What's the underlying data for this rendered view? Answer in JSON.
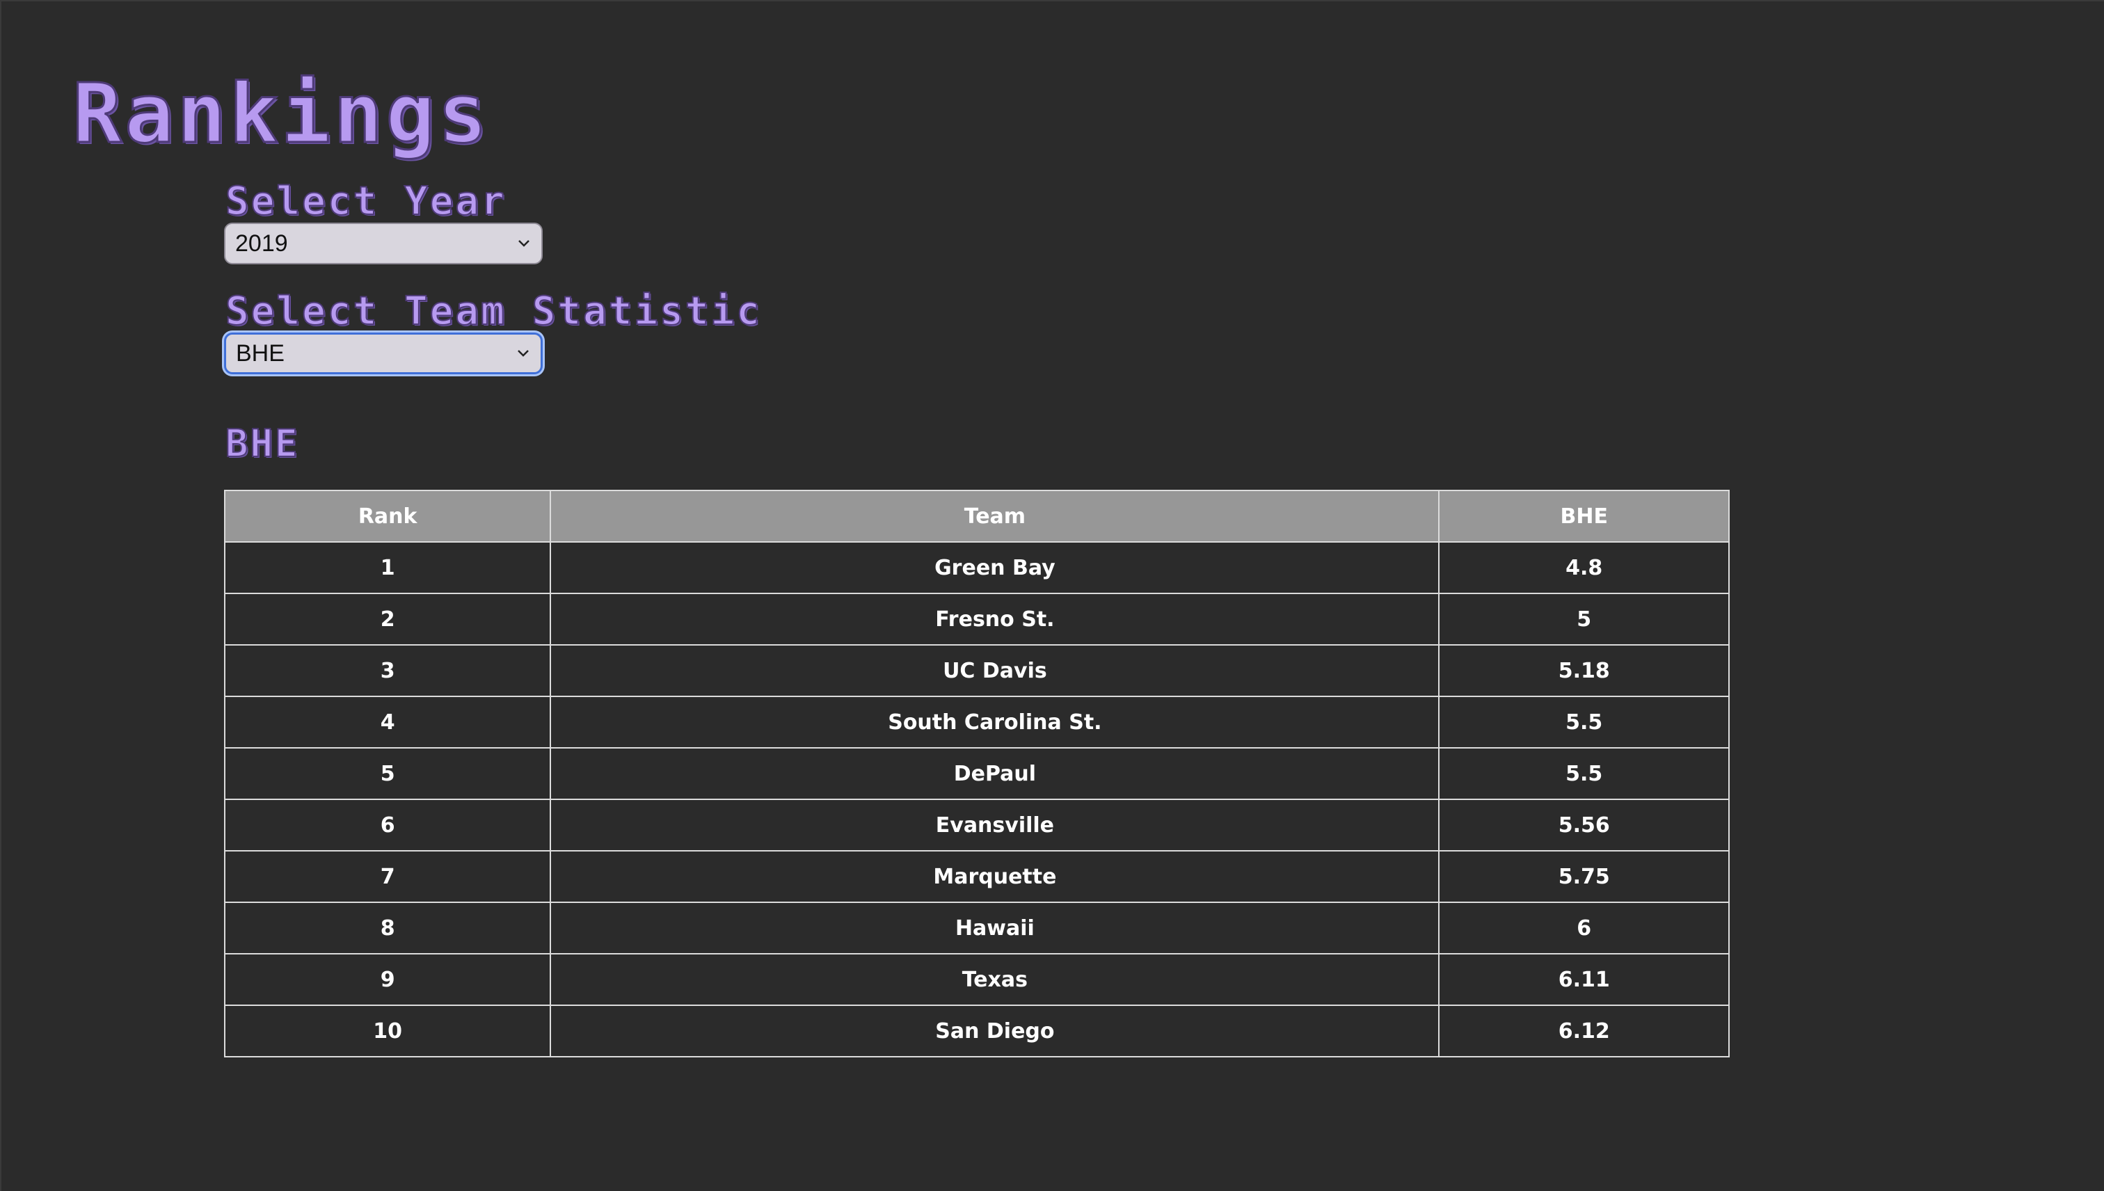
{
  "page": {
    "title": "Rankings"
  },
  "year_selector": {
    "label": "Select Year",
    "selected": "2019"
  },
  "stat_selector": {
    "label": "Select Team Statistic",
    "selected": "BHE"
  },
  "stat_heading": "BHE",
  "table": {
    "headers": [
      "Rank",
      "Team",
      "BHE"
    ],
    "rows": [
      {
        "rank": "1",
        "team": "Green Bay",
        "value": "4.8"
      },
      {
        "rank": "2",
        "team": "Fresno St.",
        "value": "5"
      },
      {
        "rank": "3",
        "team": "UC Davis",
        "value": "5.18"
      },
      {
        "rank": "4",
        "team": "South Carolina St.",
        "value": "5.5"
      },
      {
        "rank": "5",
        "team": "DePaul",
        "value": "5.5"
      },
      {
        "rank": "6",
        "team": "Evansville",
        "value": "5.56"
      },
      {
        "rank": "7",
        "team": "Marquette",
        "value": "5.75"
      },
      {
        "rank": "8",
        "team": "Hawaii",
        "value": "6"
      },
      {
        "rank": "9",
        "team": "Texas",
        "value": "6.11"
      },
      {
        "rank": "10",
        "team": "San Diego",
        "value": "6.12"
      }
    ]
  },
  "icons": {
    "dropdown": "chevron-down-icon"
  },
  "colors": {
    "background": "#2b2b2b",
    "heading": "#b79af0",
    "table_header_bg": "#979797",
    "focus_ring": "#3f6fd8"
  }
}
